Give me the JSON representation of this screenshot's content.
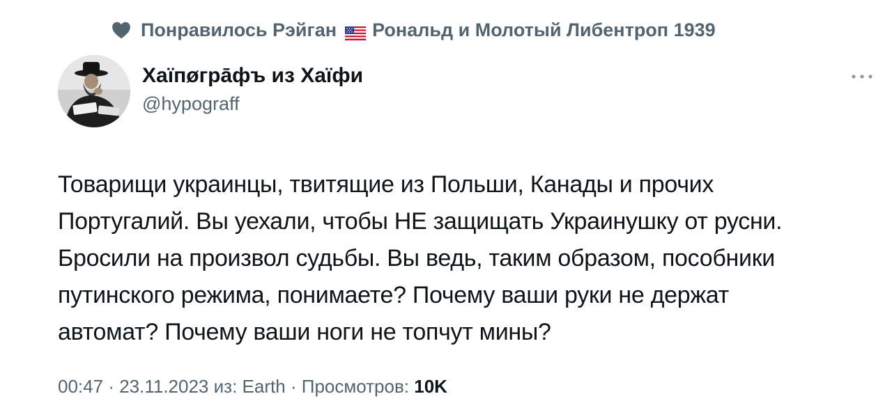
{
  "social_context": {
    "icon": "heart-icon",
    "prefix": "Понравилось Рэйган",
    "flag_icon": "us-flag-icon",
    "suffix": "Рональд и Молотый Либентроп 1939"
  },
  "author": {
    "display_name": "Хаїпøгрāфъ из Хаїфи",
    "handle": "@hypograff",
    "avatar": "avatar-photo"
  },
  "more_button": {
    "icon": "more-dots-icon"
  },
  "tweet": {
    "lines": [
      "Товарищи украинцы, твитящие из Польши, Канады и прочих",
      "Португалий. Вы уехали, чтобы НЕ защищать Украинушку от русни.",
      "Бросили на произвол судьбы. Вы ведь, таким образом, пособники",
      "путинского режима, понимаете? Почему ваши руки не держат",
      "автомат? Почему ваши ноги не топчут мины?"
    ]
  },
  "meta": {
    "time": "00:47",
    "separator": " · ",
    "date": "23.11.2023",
    "source": "из: Earth",
    "views_label": "Просмотров:",
    "views_count": "10K"
  },
  "colors": {
    "text_primary": "#0f1419",
    "text_secondary": "#536471",
    "background": "#ffffff"
  }
}
